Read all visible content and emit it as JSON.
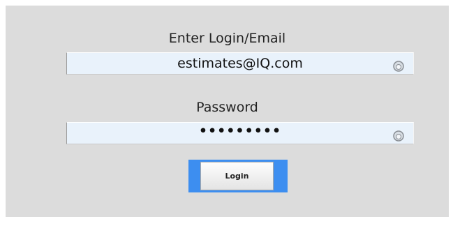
{
  "login": {
    "label": "Enter Login/Email",
    "value": "estimates@IQ.com",
    "icon": "circle-indicator-icon"
  },
  "password": {
    "label": "Password",
    "masked_value": "•••••••••",
    "icon": "circle-indicator-icon"
  },
  "login_button": {
    "label": "Login",
    "accent_color": "#3d8ef0"
  },
  "colors": {
    "panel_background": "#dcdcdc",
    "field_background": "#e9f2fb"
  }
}
